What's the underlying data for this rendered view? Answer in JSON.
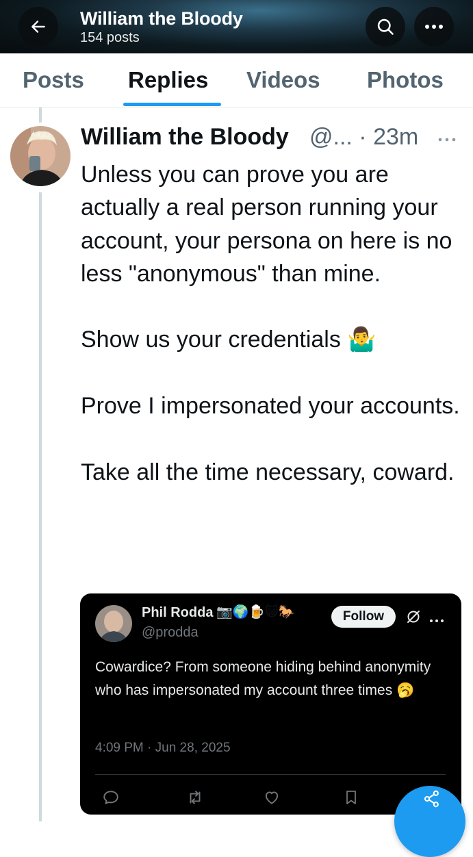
{
  "header": {
    "title": "William the Bloody",
    "subtitle": "154 posts",
    "icons": [
      "back-arrow-icon",
      "search-icon",
      "more-icon"
    ]
  },
  "tabs": [
    {
      "label": "Posts",
      "active": false
    },
    {
      "label": "Replies",
      "active": true
    },
    {
      "label": "Videos",
      "active": false
    },
    {
      "label": "Photos",
      "active": false
    }
  ],
  "tweet": {
    "display_name": "William the Bloody",
    "handle_time": "@... · 23m",
    "paragraphs": [
      "Unless you can prove you are actually a real person running your account, your persona on here is no less \"anonymous\" than mine.",
      "Show us your credentials 🤷‍♂️",
      "Prove I impersonated your accounts.",
      "Take all the time necessary, coward."
    ]
  },
  "quote": {
    "display_name": "Phil Rodda",
    "name_emojis": "📷🌍🍺😺🐎",
    "handle": "@prodda",
    "follow_label": "Follow",
    "text": "Cowardice? From someone hiding behind anonymity who has impersonated my account three times 🥱",
    "timestamp": "4:09 PM · Jun 28, 2025",
    "actions": [
      "reply-icon",
      "repost-icon",
      "like-icon",
      "bookmark-icon"
    ]
  },
  "colors": {
    "accent": "#1d9bf0",
    "text_primary": "#0f1419",
    "text_secondary": "#536471"
  }
}
